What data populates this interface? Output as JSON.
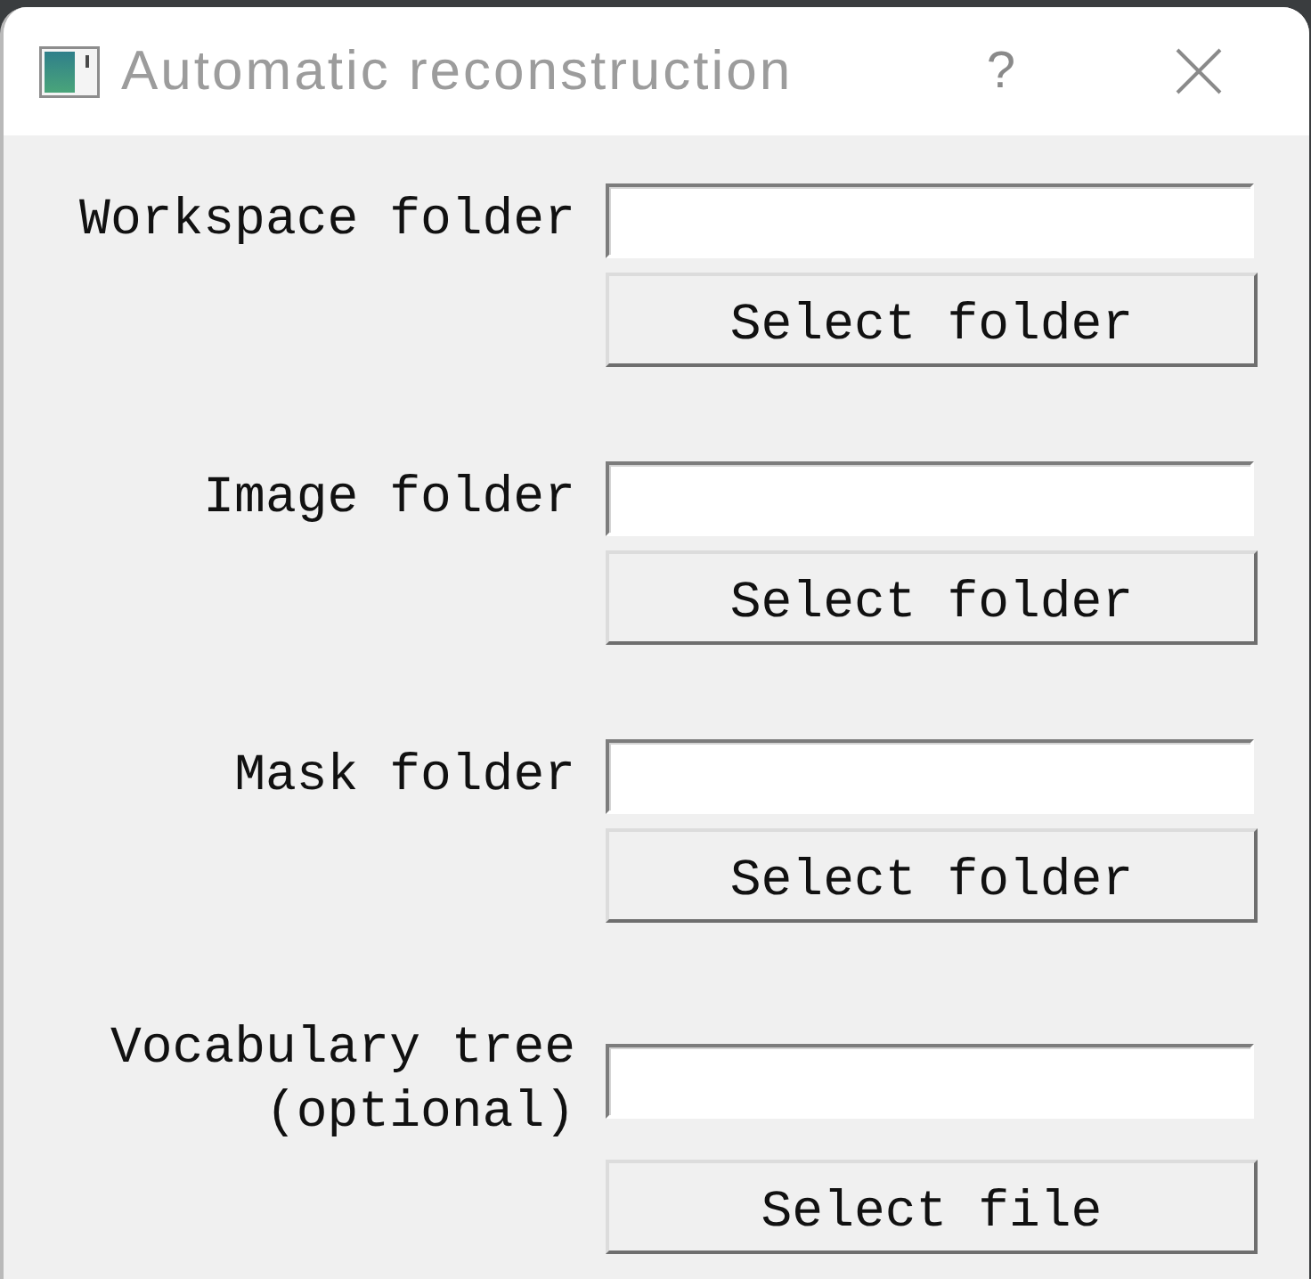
{
  "window": {
    "title": "Automatic reconstruction",
    "help_button": "?"
  },
  "fields": [
    {
      "label": "Workspace folder",
      "button": "Select folder"
    },
    {
      "label": "Image folder",
      "button": "Select folder"
    },
    {
      "label": "Mask folder",
      "button": "Select folder"
    },
    {
      "label": "Vocabulary tree (optional)",
      "button": "Select file"
    }
  ]
}
